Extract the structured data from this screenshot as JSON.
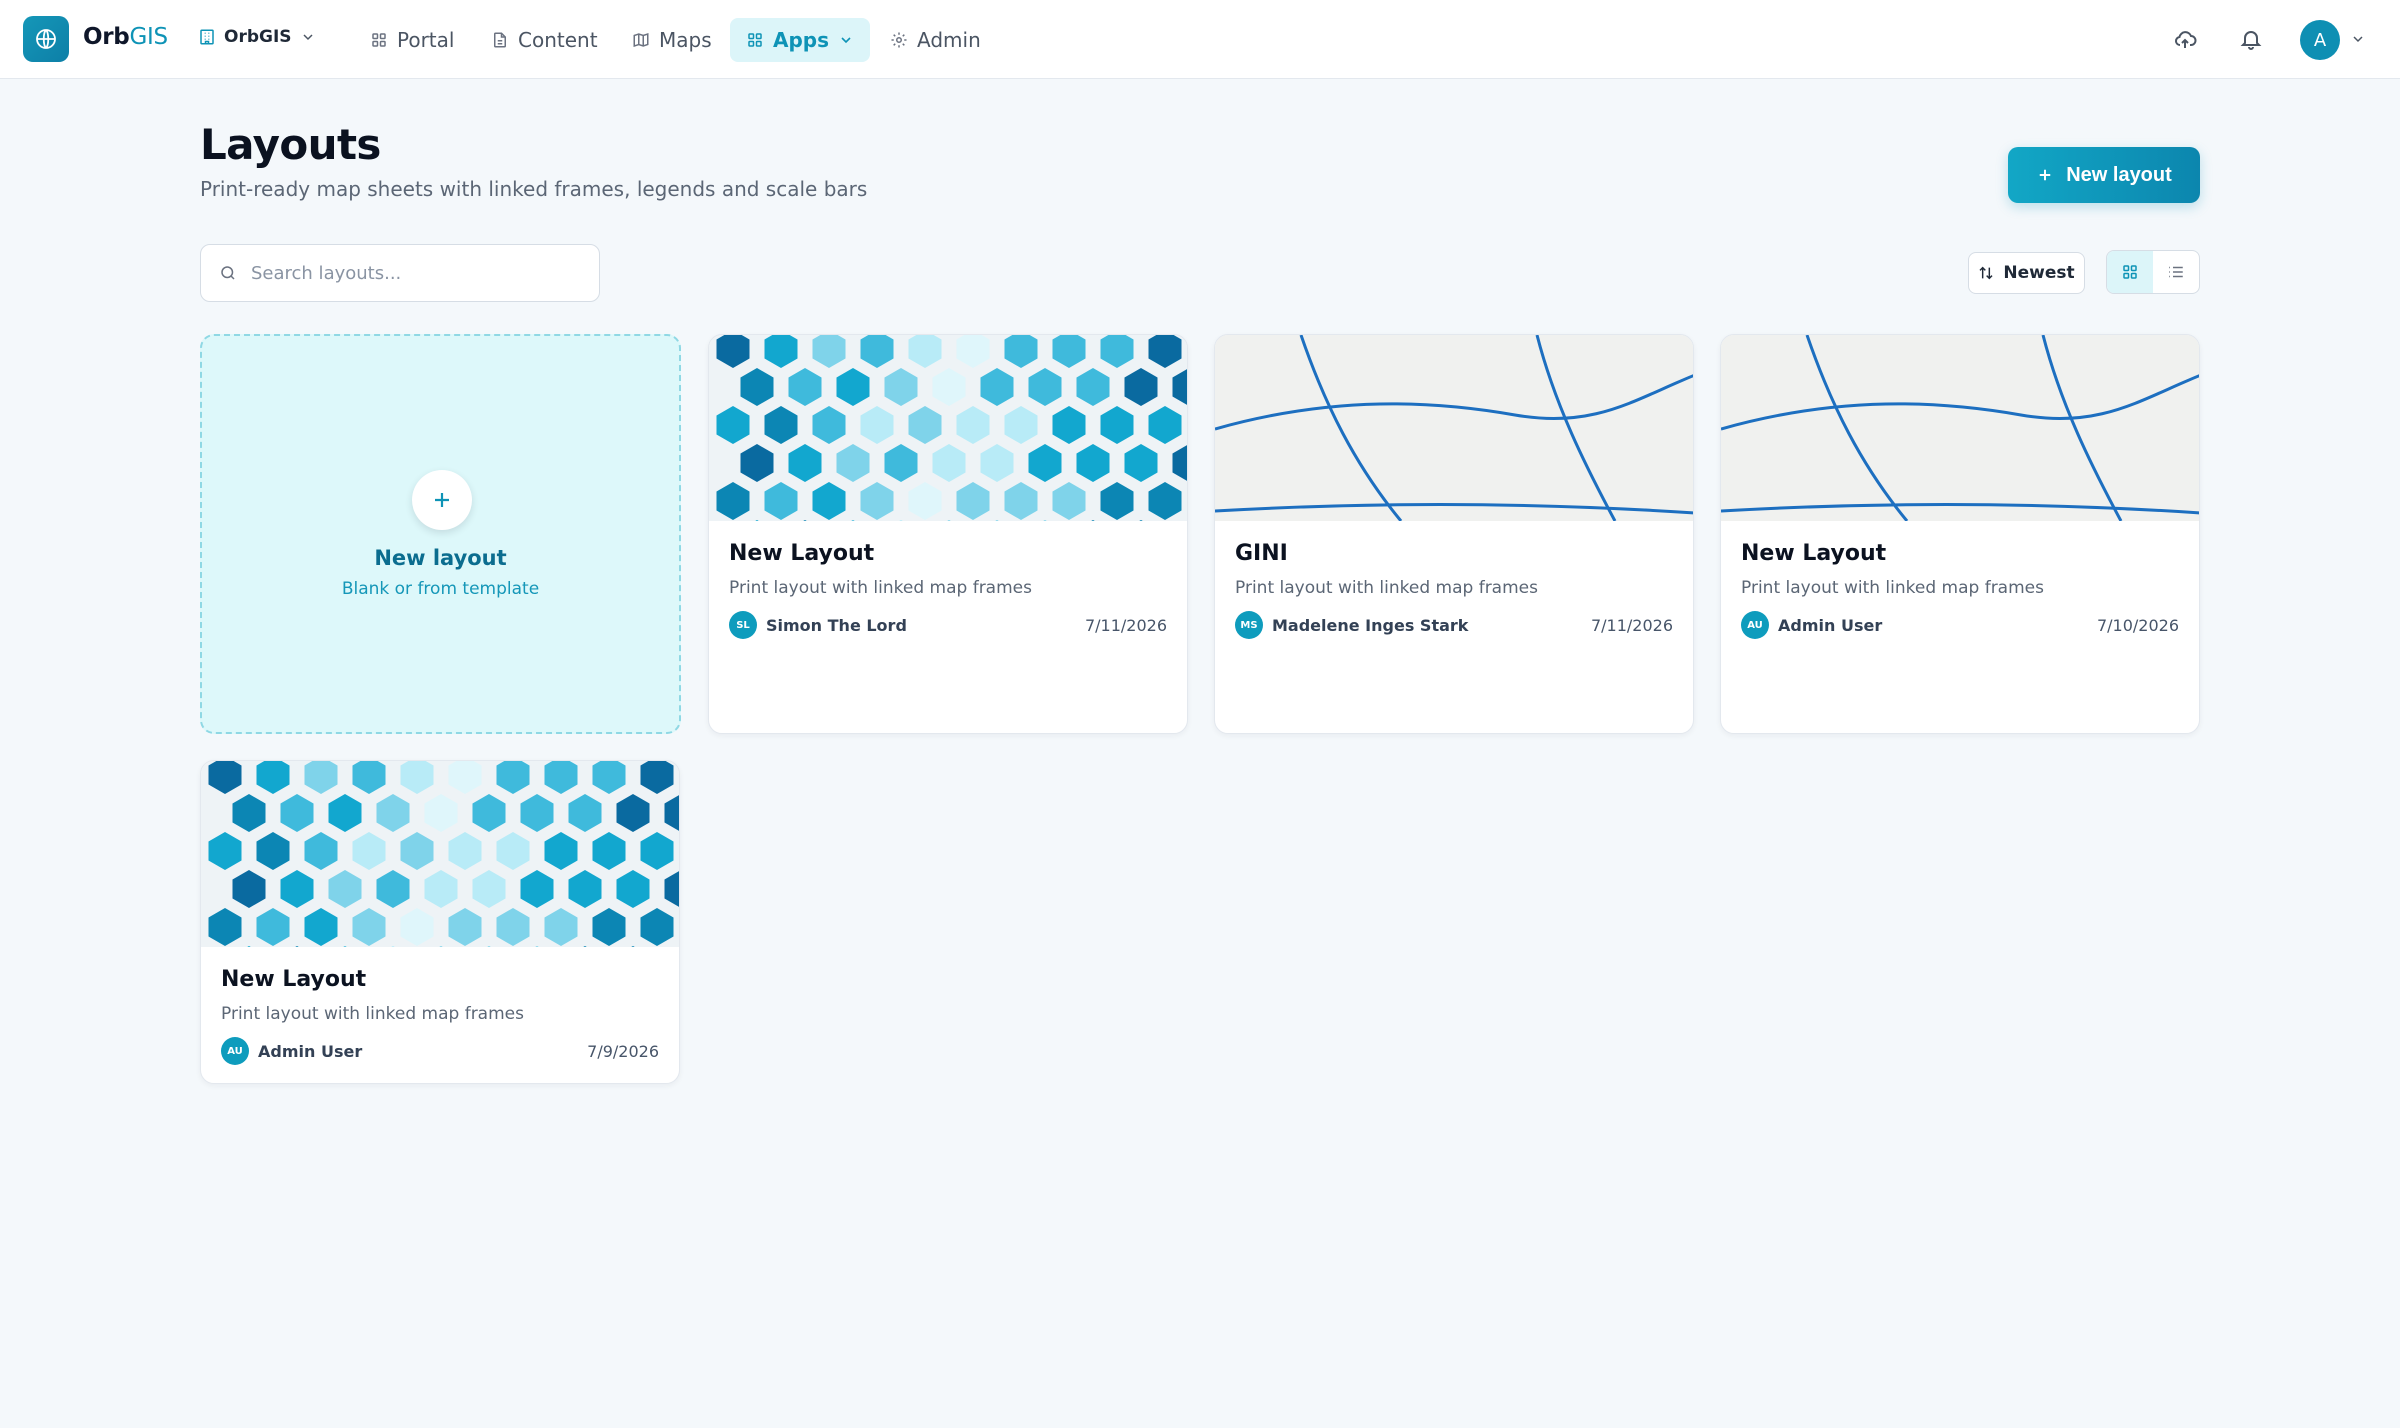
{
  "app": {
    "brand_part1": "Orb",
    "brand_part2": "GIS",
    "org_name": "OrbGIS",
    "accent_color": "#0e93b6"
  },
  "nav": {
    "items": [
      {
        "label": "Portal",
        "icon": "grid-icon"
      },
      {
        "label": "Content",
        "icon": "document-icon"
      },
      {
        "label": "Maps",
        "icon": "map-icon"
      },
      {
        "label": "Apps",
        "icon": "apps-icon",
        "active": true
      },
      {
        "label": "Admin",
        "icon": "gear-icon"
      }
    ]
  },
  "user": {
    "initial": "A"
  },
  "header": {
    "title": "Layouts",
    "subtitle": "Print-ready map sheets with linked frames, legends and scale bars",
    "new_button": "New layout"
  },
  "toolbar": {
    "search_placeholder": "Search layouts...",
    "sort_label": "Newest"
  },
  "new_card": {
    "title": "New layout",
    "subtitle": "Blank or from template"
  },
  "layouts": [
    {
      "title": "New Layout",
      "description": "Print layout with linked map frames",
      "owner": "Simon The Lord",
      "initials": "SL",
      "date": "7/11/2026",
      "thumb": "hexgrid"
    },
    {
      "title": "GINI",
      "description": "Print layout with linked map frames",
      "owner": "Madelene Inges Stark",
      "initials": "MS",
      "date": "7/11/2026",
      "thumb": "lines"
    },
    {
      "title": "New Layout",
      "description": "Print layout with linked map frames",
      "owner": "Admin User",
      "initials": "AU",
      "date": "7/10/2026",
      "thumb": "lines"
    },
    {
      "title": "New Layout",
      "description": "Print layout with linked map frames",
      "owner": "Admin User",
      "initials": "AU",
      "date": "7/9/2026",
      "thumb": "hexgrid"
    }
  ]
}
